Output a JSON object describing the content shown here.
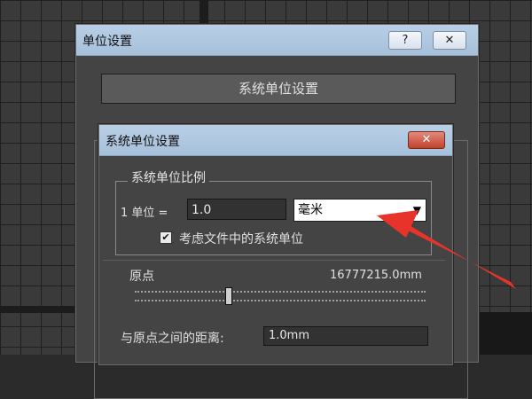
{
  "outer_dialog": {
    "title": "单位设置",
    "help_glyph": "?",
    "close_glyph": "✕",
    "system_units_button": "系统单位设置"
  },
  "inner_dialog": {
    "title": "系统单位设置",
    "close_glyph": "✕",
    "group_title": "系统单位比例",
    "unit_label": "1 单位 =",
    "unit_value": "1.0",
    "unit_select": "毫米",
    "unit_select_arrow": "▼",
    "checkbox_checked": true,
    "checkbox_glyph": "✔",
    "checkbox_label": "考虑文件中的系统单位",
    "origin_label": "原点",
    "origin_value": "16777215.0mm",
    "distance_label": "与原点之间的距离:",
    "distance_value": "1.0mm"
  },
  "colors": {
    "titlebar": "#b8cfe6",
    "annotation_arrow": "#e8332a",
    "close_button": "#c3412c"
  }
}
